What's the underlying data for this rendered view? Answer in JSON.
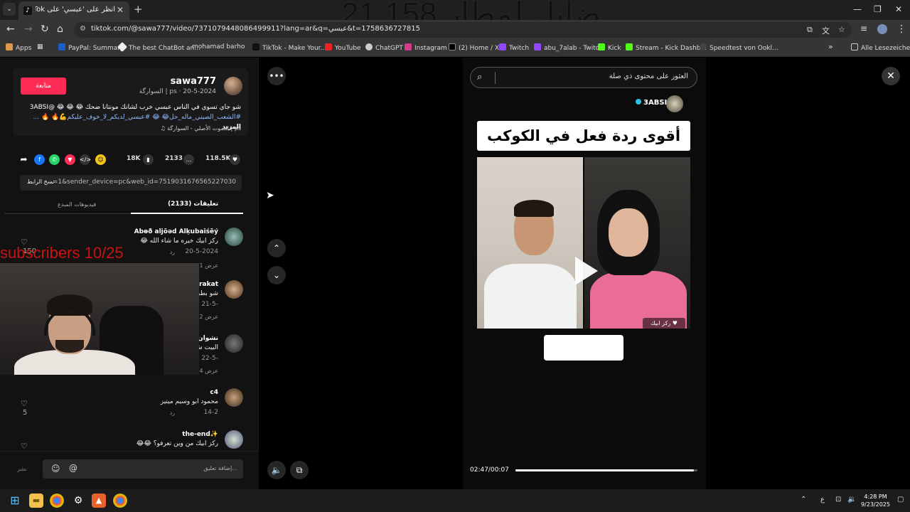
{
  "overlay": {
    "counter": "ضايل لمطار 21.158",
    "subscribers": "subscribers 10/25"
  },
  "browser": {
    "tab_title": "انظر على 'عبسي' على TikTok | يد...",
    "url": "tiktok.com/@sawa777/video/7371079448086499911?lang=ar&q=عبسي&t=1758636727815",
    "bookmarks": [
      "Apps",
      "PayPal: Summary",
      "The best ChatBot an...",
      "mohamad barho",
      "TikTok - Make Your...",
      "YouTube",
      "ChatGPT",
      "Instagram",
      "(2) Home / X",
      "Twitch",
      "abu_7alab - Twitch",
      "Kick",
      "Stream - Kick Dashb...",
      "Speedtest von Ookl..."
    ],
    "all_bookmarks": "Alle Lesezeichen"
  },
  "post": {
    "follow": "متابعة",
    "username": "sawa777",
    "meta": "السوارگة | ps · 20-5-2024",
    "caption": "شو جاي تسوي في الناس عبسي خرب لشانك مونتانا ضحك 😂 😂 😂 @3ABSI",
    "hashtags": "#الشعب_الصيني_ماله_حل😂 😂 #عبسي_لديكم_لا_خوف_عليكم💪🔥 🔥 ...",
    "more": "المزيد",
    "sound": "♫ الصوت الأصلي - السوارگة | ps"
  },
  "actions": {
    "likes": "118.5K",
    "comments": "2133",
    "saves": "18K"
  },
  "link": {
    "copy": "نسخ الرابط",
    "url": "...=1&sender_device=pc&web_id=7519031676565227030"
  },
  "tabs": {
    "comments": "تعليقات (2133)",
    "creator": "فيديوهات المبدع"
  },
  "comments": [
    {
      "name": "Abөð aljōəd Alķubaiśēý",
      "text": "ركز ابيك خيره ما شاء الله 😂",
      "date": "20-5-2024",
      "reply": "رد",
      "likes": "150",
      "views": "عرض 1 رد"
    },
    {
      "name": "arakat",
      "text": "شو بطي",
      "date": "21-5-",
      "reply": "",
      "likes": "",
      "views": "عرض 2"
    },
    {
      "name": "نشوان 8",
      "text": "البيت ش",
      "date": "22-5-",
      "reply": "",
      "likes": "",
      "views": "عرض 4 ردود"
    },
    {
      "name": "c4",
      "text": "محمود ابو وسيم ميتيز",
      "date": "14-2",
      "reply": "رد",
      "likes": "5",
      "views": ""
    },
    {
      "name": "the-end✨",
      "text": "ركز ابيك من وين تعرفو؟ 😂😂",
      "date": "",
      "reply": "",
      "likes": "",
      "views": ""
    }
  ],
  "input": {
    "placeholder": "إضافة تعليق...",
    "post": "نشر"
  },
  "video": {
    "search_placeholder": "العثور على محتوى ذي صلة",
    "user": "3ABSI",
    "title": "أقوى ردة فعل في الكوكب 😂",
    "sticker": "ركز ابيك ♥",
    "emoji_box": "😂😂😂😂",
    "time": "02:47/00:07",
    "progress": 0.98
  },
  "taskbar": {
    "time": "4:28 PM",
    "date": "9/23/2025",
    "lang": "ع"
  }
}
